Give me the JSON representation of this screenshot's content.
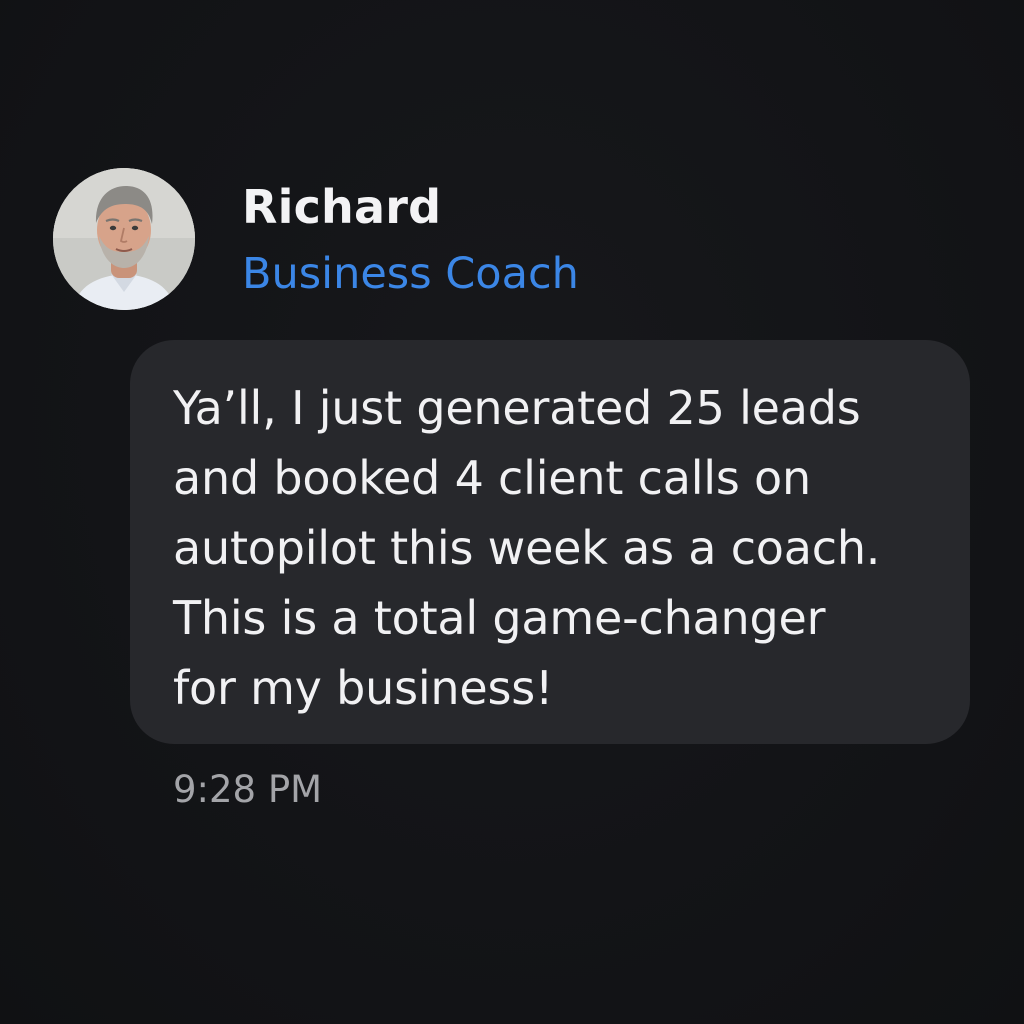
{
  "sender": {
    "name": "Richard",
    "role": "Business Coach",
    "avatar_icon": "profile-photo"
  },
  "message": {
    "lines": [
      "Ya’ll, I just generated 25 leads",
      "and booked 4 client calls on",
      "autopilot this week as a coach.",
      "This is a total game-changer",
      "for my business!"
    ],
    "timestamp": "9:28 PM"
  },
  "colors": {
    "background": "#131417",
    "bubble": "#27282c",
    "role_accent": "#3b86e6",
    "timestamp": "#a3a4a8"
  }
}
